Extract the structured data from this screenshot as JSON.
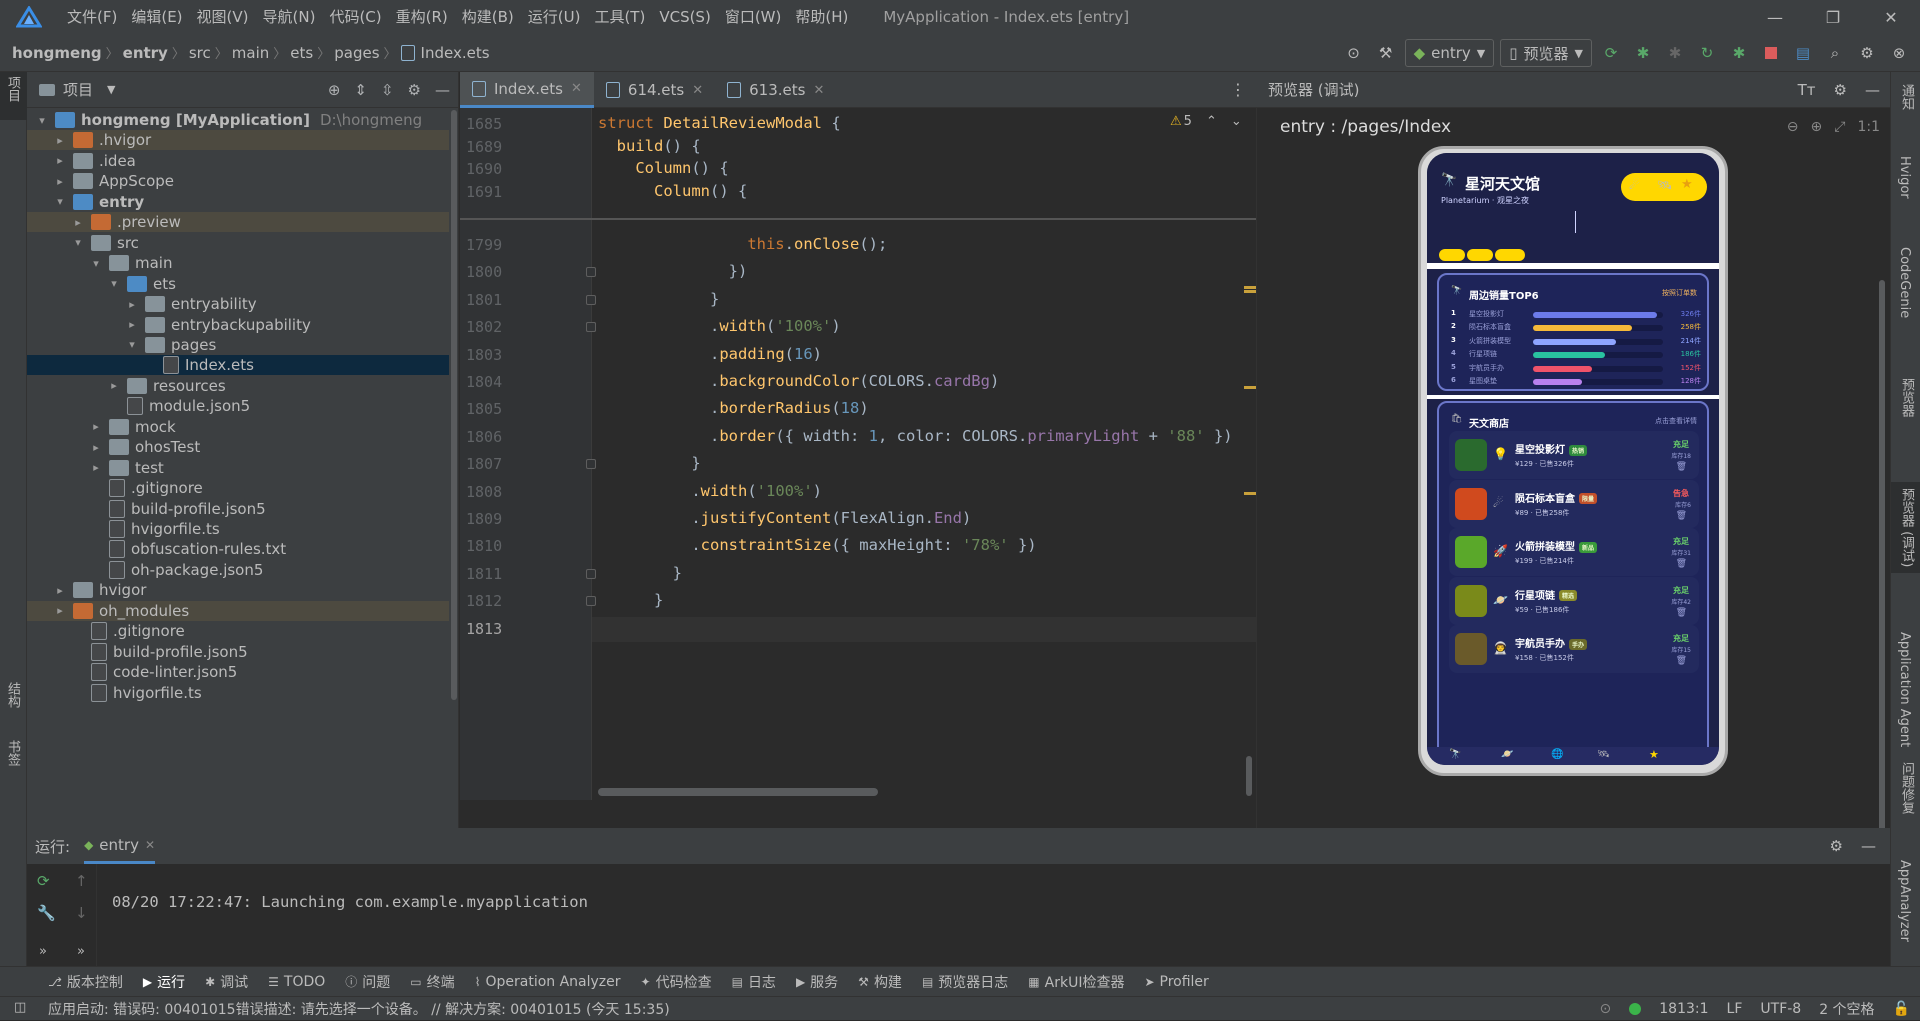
{
  "menubar": {
    "items": [
      "文件(F)",
      "编辑(E)",
      "视图(V)",
      "导航(N)",
      "代码(C)",
      "重构(R)",
      "构建(B)",
      "运行(U)",
      "工具(T)",
      "VCS(S)",
      "窗口(W)",
      "帮助(H)"
    ],
    "window_title": "MyApplication - Index.ets [entry]"
  },
  "breadcrumb": [
    "hongmeng",
    "entry",
    "src",
    "main",
    "ets",
    "pages",
    "Index.ets"
  ],
  "toolbar": {
    "run_config": "entry",
    "device": "预览器"
  },
  "project_panel": {
    "title": "项目",
    "tree": [
      {
        "label": "hongmeng [MyApplication]",
        "hint": "D:\\hongmeng",
        "depth": 0,
        "arrow": "▾",
        "icon": "folder-blue",
        "bold": true
      },
      {
        "label": ".hvigor",
        "depth": 1,
        "arrow": "▸",
        "icon": "folder-orange",
        "state": "hl"
      },
      {
        "label": ".idea",
        "depth": 1,
        "arrow": "▸",
        "icon": "folder"
      },
      {
        "label": "AppScope",
        "depth": 1,
        "arrow": "▸",
        "icon": "folder"
      },
      {
        "label": "entry",
        "depth": 1,
        "arrow": "▾",
        "icon": "folder-blue",
        "bold": true
      },
      {
        "label": ".preview",
        "depth": 2,
        "arrow": "▸",
        "icon": "folder-orange",
        "state": "hl"
      },
      {
        "label": "src",
        "depth": 2,
        "arrow": "▾",
        "icon": "folder"
      },
      {
        "label": "main",
        "depth": 3,
        "arrow": "▾",
        "icon": "folder"
      },
      {
        "label": "ets",
        "depth": 4,
        "arrow": "▾",
        "icon": "folder-blue"
      },
      {
        "label": "entryability",
        "depth": 5,
        "arrow": "▸",
        "icon": "folder"
      },
      {
        "label": "entrybackupability",
        "depth": 5,
        "arrow": "▸",
        "icon": "folder"
      },
      {
        "label": "pages",
        "depth": 5,
        "arrow": "▾",
        "icon": "folder"
      },
      {
        "label": "Index.ets",
        "depth": 6,
        "arrow": "",
        "icon": "file",
        "state": "sel"
      },
      {
        "label": "resources",
        "depth": 4,
        "arrow": "▸",
        "icon": "folder"
      },
      {
        "label": "module.json5",
        "depth": 4,
        "arrow": "",
        "icon": "file"
      },
      {
        "label": "mock",
        "depth": 3,
        "arrow": "▸",
        "icon": "folder"
      },
      {
        "label": "ohosTest",
        "depth": 3,
        "arrow": "▸",
        "icon": "folder"
      },
      {
        "label": "test",
        "depth": 3,
        "arrow": "▸",
        "icon": "folder"
      },
      {
        "label": ".gitignore",
        "depth": 3,
        "arrow": "",
        "icon": "file"
      },
      {
        "label": "build-profile.json5",
        "depth": 3,
        "arrow": "",
        "icon": "file"
      },
      {
        "label": "hvigorfile.ts",
        "depth": 3,
        "arrow": "",
        "icon": "file"
      },
      {
        "label": "obfuscation-rules.txt",
        "depth": 3,
        "arrow": "",
        "icon": "file"
      },
      {
        "label": "oh-package.json5",
        "depth": 3,
        "arrow": "",
        "icon": "file"
      },
      {
        "label": "hvigor",
        "depth": 1,
        "arrow": "▸",
        "icon": "folder"
      },
      {
        "label": "oh_modules",
        "depth": 1,
        "arrow": "▸",
        "icon": "folder-orange",
        "state": "hl"
      },
      {
        "label": ".gitignore",
        "depth": 2,
        "arrow": "",
        "icon": "file"
      },
      {
        "label": "build-profile.json5",
        "depth": 2,
        "arrow": "",
        "icon": "file"
      },
      {
        "label": "code-linter.json5",
        "depth": 2,
        "arrow": "",
        "icon": "file"
      },
      {
        "label": "hvigorfile.ts",
        "depth": 2,
        "arrow": "",
        "icon": "file"
      }
    ]
  },
  "editor": {
    "tabs": [
      {
        "label": "Index.ets",
        "active": true
      },
      {
        "label": "614.ets"
      },
      {
        "label": "613.ets"
      }
    ],
    "warnings": "5",
    "sticky": [
      {
        "ln": "1685",
        "html": "<span class='kw'>struct</span> <span class='cls'>DetailReviewModal</span> {"
      },
      {
        "ln": "1689",
        "html": "  <span class='mth'>build</span>() {"
      },
      {
        "ln": "1690",
        "html": "    <span class='cls'>Column</span>() {"
      },
      {
        "ln": "1691",
        "html": "      <span class='cls'>Column</span>() {"
      }
    ],
    "lines": [
      {
        "ln": "1799",
        "html": "                <span class='kw'>this</span>.<span class='mth'>onClose</span>();"
      },
      {
        "ln": "1800",
        "html": "              })"
      },
      {
        "ln": "1801",
        "html": "            }"
      },
      {
        "ln": "1802",
        "html": "            .<span class='mth'>width</span>(<span class='str'>'100%'</span>)"
      },
      {
        "ln": "1803",
        "html": "            .<span class='mth'>padding</span>(<span class='num'>16</span>)"
      },
      {
        "ln": "1804",
        "html": "            .<span class='mth'>backgroundColor</span>(COLORS.<span class='fld'>cardBg</span>)"
      },
      {
        "ln": "1805",
        "html": "            .<span class='mth'>borderRadius</span>(<span class='num'>18</span>)"
      },
      {
        "ln": "1806",
        "html": "            .<span class='mth'>border</span>({ width: <span class='num'>1</span>, color: COLORS.<span class='fld'>primaryLight</span> + <span class='str'>'88'</span> })"
      },
      {
        "ln": "1807",
        "html": "          }"
      },
      {
        "ln": "1808",
        "html": "          .<span class='mth'>width</span>(<span class='str'>'100%'</span>)"
      },
      {
        "ln": "1809",
        "html": "          .<span class='mth'>justifyContent</span>(FlexAlign.<span class='fld'>End</span>)"
      },
      {
        "ln": "1810",
        "html": "          .<span class='mth'>constraintSize</span>({ maxHeight: <span class='str'>'78%'</span> })"
      },
      {
        "ln": "1811",
        "html": "        }"
      },
      {
        "ln": "1812",
        "html": "      }"
      },
      {
        "ln": "1813",
        "html": ""
      }
    ]
  },
  "preview": {
    "header": "预览器 (调试)",
    "route": "entry : /pages/Index",
    "app_title": "星河天文馆",
    "app_subtitle": "Planetarium · 观星之夜",
    "rank_title": "周边销量TOP6",
    "rank_hint": "按照订单数",
    "ranks": [
      {
        "n": "1",
        "name": "星空投影灯",
        "value": "326件",
        "fill": 0.95,
        "color": "#6c7bea"
      },
      {
        "n": "2",
        "name": "陨石标本盲盒",
        "value": "258件",
        "fill": 0.76,
        "color": "#f5b93a"
      },
      {
        "n": "3",
        "name": "火箭拼装模型",
        "value": "214件",
        "fill": 0.64,
        "color": "#8ea4ff"
      },
      {
        "n": "4",
        "name": "行星项链",
        "value": "186件",
        "fill": 0.55,
        "color": "#29c2a0"
      },
      {
        "n": "5",
        "name": "宇航员手办",
        "value": "152件",
        "fill": 0.45,
        "color": "#f0536a"
      },
      {
        "n": "6",
        "name": "星图桌垫",
        "value": "128件",
        "fill": 0.38,
        "color": "#b981ee"
      }
    ],
    "shop_title": "天文商店",
    "shop_hint": "点击查看详情",
    "shop": [
      {
        "name": "星空投影灯",
        "tag": "热销",
        "tagColor": "#2e8a3d",
        "price": "¥129 · 已售326件",
        "status": "充足",
        "statusColor": "#6ad36a",
        "stock": "库存18",
        "swatch": "#2a6a2e",
        "emoji": "💡"
      },
      {
        "name": "陨石标本盲盒",
        "tag": "限量",
        "tagColor": "#c2502a",
        "price": "¥89 · 已售258件",
        "status": "告急",
        "statusColor": "#ff5c5c",
        "stock": "库存6",
        "swatch": "#d04a1e",
        "emoji": "☄"
      },
      {
        "name": "火箭拼装模型",
        "tag": "新品",
        "tagColor": "#3a9a3a",
        "price": "¥199 · 已售214件",
        "status": "充足",
        "statusColor": "#6ad36a",
        "stock": "库存31",
        "swatch": "#5aa82a",
        "emoji": "🚀"
      },
      {
        "name": "行星项链",
        "tag": "精选",
        "tagColor": "#8a8a2a",
        "price": "¥59 · 已售186件",
        "status": "充足",
        "statusColor": "#6ad36a",
        "stock": "库存42",
        "swatch": "#7a8a1a",
        "emoji": "🪐"
      },
      {
        "name": "宇航员手办",
        "tag": "手办",
        "tagColor": "#6a6a2a",
        "price": "¥158 · 已售152件",
        "status": "充足",
        "statusColor": "#6ad36a",
        "stock": "库存15",
        "swatch": "#6a5a2a",
        "emoji": "👨‍🚀"
      }
    ]
  },
  "run": {
    "label": "运行:",
    "tab": "entry",
    "log": "08/20 17:22:47: Launching com.example.myapplication"
  },
  "bottom_tabs": [
    "版本控制",
    "运行",
    "调试",
    "TODO",
    "问题",
    "终端",
    "Operation Analyzer",
    "代码检查",
    "日志",
    "服务",
    "构建",
    "预览器日志",
    "ArkUI检查器",
    "Profiler"
  ],
  "left_strip": {
    "top": "项目",
    "bottom1": "结构",
    "bottom2": "书签"
  },
  "right_strip": [
    "通知",
    "Hvigor",
    "CodeGenie",
    "预览器",
    "预览器 (调试)",
    "Application Agent",
    "问题修复",
    "AppAnalyzer"
  ],
  "statusbar": {
    "message": "应用启动: 错误码: 00401015错误描述: 请先选择一个设备。 // 解决方案: 00401015 (今天 15:35)",
    "position": "1813:1",
    "eol": "LF",
    "encoding": "UTF-8",
    "indent": "2 个空格"
  }
}
